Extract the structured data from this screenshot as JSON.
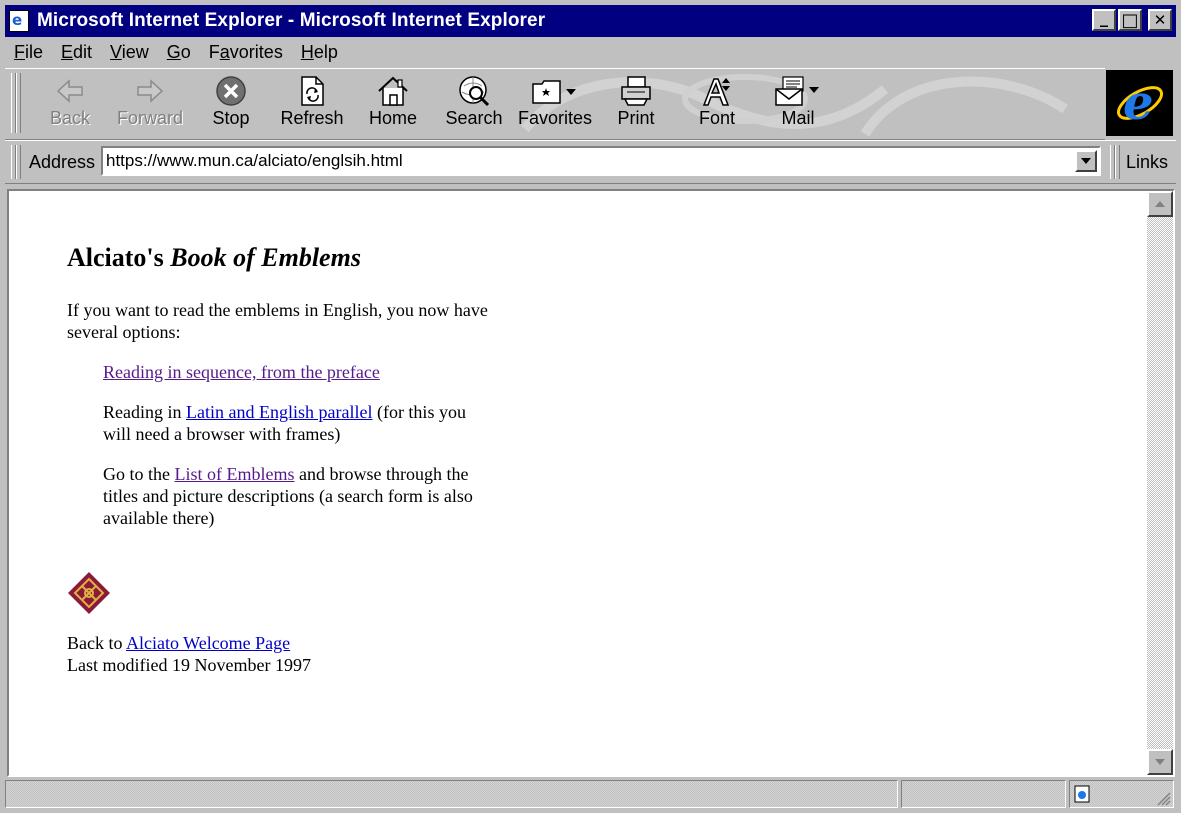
{
  "window": {
    "title": "Microsoft Internet Explorer - Microsoft Internet Explorer",
    "minimize": "_",
    "maximize": "□",
    "close": "✕"
  },
  "menu": [
    {
      "label": "File",
      "underline": "F",
      "rest": "ile"
    },
    {
      "label": "Edit",
      "underline": "E",
      "rest": "dit"
    },
    {
      "label": "View",
      "underline": "V",
      "rest": "iew"
    },
    {
      "label": "Go",
      "underline": "G",
      "rest": "o"
    },
    {
      "label": "Favorites",
      "underline": "a",
      "pre": "F",
      "rest": "vorites"
    },
    {
      "label": "Help",
      "underline": "H",
      "rest": "elp"
    }
  ],
  "toolbar": {
    "back": "Back",
    "forward": "Forward",
    "stop": "Stop",
    "refresh": "Refresh",
    "home": "Home",
    "search": "Search",
    "favorites": "Favorites",
    "print": "Print",
    "font": "Font",
    "mail": "Mail"
  },
  "address": {
    "label": "Address",
    "url": "https://www.mun.ca/alciato/englsih.html",
    "links": "Links"
  },
  "page": {
    "heading_plain": "Alciato's ",
    "heading_italic": "Book of Emblems",
    "intro": "If you want to read the emblems in English, you now have several options:",
    "option1_link": "Reading in sequence, from the preface",
    "option2_pre": "Reading in ",
    "option2_link": "Latin and English parallel",
    "option2_post": " (for this you will need a browser with frames)",
    "option3_pre": "Go to the ",
    "option3_link": "List of Emblems",
    "option3_post": " and browse through the titles and picture descriptions (a search form is also available there)",
    "back_pre": "Back to ",
    "back_link": "Alciato Welcome Page",
    "modified": "Last modified 19 November 1997"
  },
  "colors": {
    "titlebar": "#000080",
    "link": "#0000cc",
    "visited_link": "#551a8b",
    "chrome": "#c0c0c0",
    "emblem": "#8b1a3a"
  },
  "icons": [
    "back-arrow-icon",
    "forward-arrow-icon",
    "stop-icon",
    "refresh-icon",
    "home-icon",
    "search-icon",
    "favorites-icon",
    "print-icon",
    "font-icon",
    "mail-icon",
    "ie-logo-icon",
    "knot-emblem-icon"
  ]
}
